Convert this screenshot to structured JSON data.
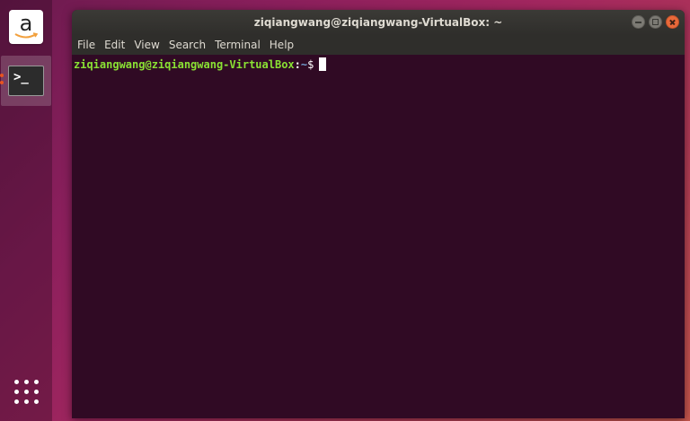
{
  "dock": {
    "amazon_letter": "a",
    "items": [
      {
        "icon": "amazon-icon"
      },
      {
        "icon": "terminal-icon",
        "glyph": ">_"
      },
      {
        "icon": "show-applications-icon"
      }
    ]
  },
  "window": {
    "title": "ziqiangwang@ziqiangwang-VirtualBox: ~"
  },
  "menu": {
    "file": "File",
    "edit": "Edit",
    "view": "View",
    "search": "Search",
    "terminal": "Terminal",
    "help": "Help"
  },
  "terminal": {
    "user_host": "ziqiangwang@ziqiangwang-VirtualBox",
    "separator": ":",
    "path": "~",
    "symbol": "$"
  },
  "colors": {
    "terminal_bg": "#300a24",
    "prompt_user": "#8ae234",
    "prompt_path": "#729fcf",
    "close_button": "#e9693a"
  }
}
